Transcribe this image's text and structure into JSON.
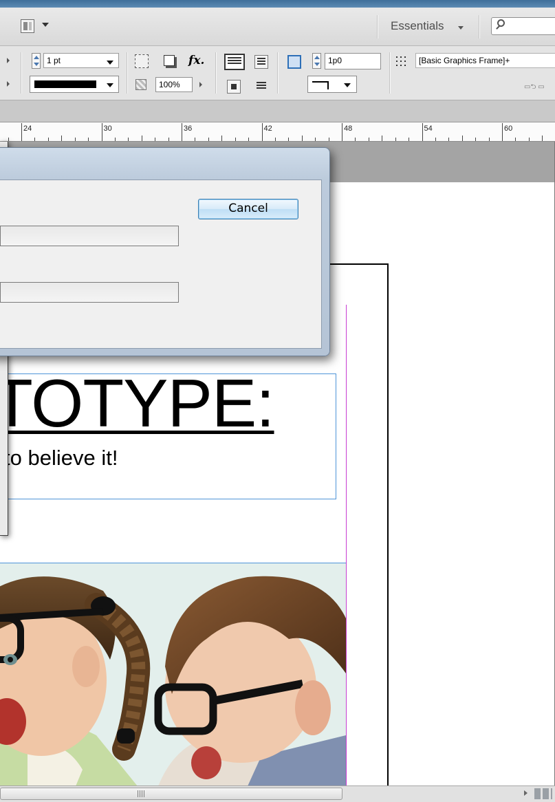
{
  "app_bar": {
    "workspace_label": "Essentials",
    "icons": [
      "layout-icon",
      "search-icon"
    ]
  },
  "control_bar": {
    "stroke_weight": "1 pt",
    "opacity": "100%",
    "spacing": "1p0",
    "object_style": "[Basic Graphics Frame]+",
    "fx_label": "fx."
  },
  "ruler": {
    "labels": [
      "24",
      "30",
      "36",
      "42",
      "48",
      "54",
      "60"
    ]
  },
  "dialog": {
    "cancel_label": "Cancel"
  },
  "document": {
    "headline": "TOTYPE:",
    "subhead": "to believe it!"
  },
  "colors": {
    "frame_blue": "#4d93d8",
    "bleed_magenta": "#c73bd1",
    "dialog_frame": "#bccbdc"
  }
}
